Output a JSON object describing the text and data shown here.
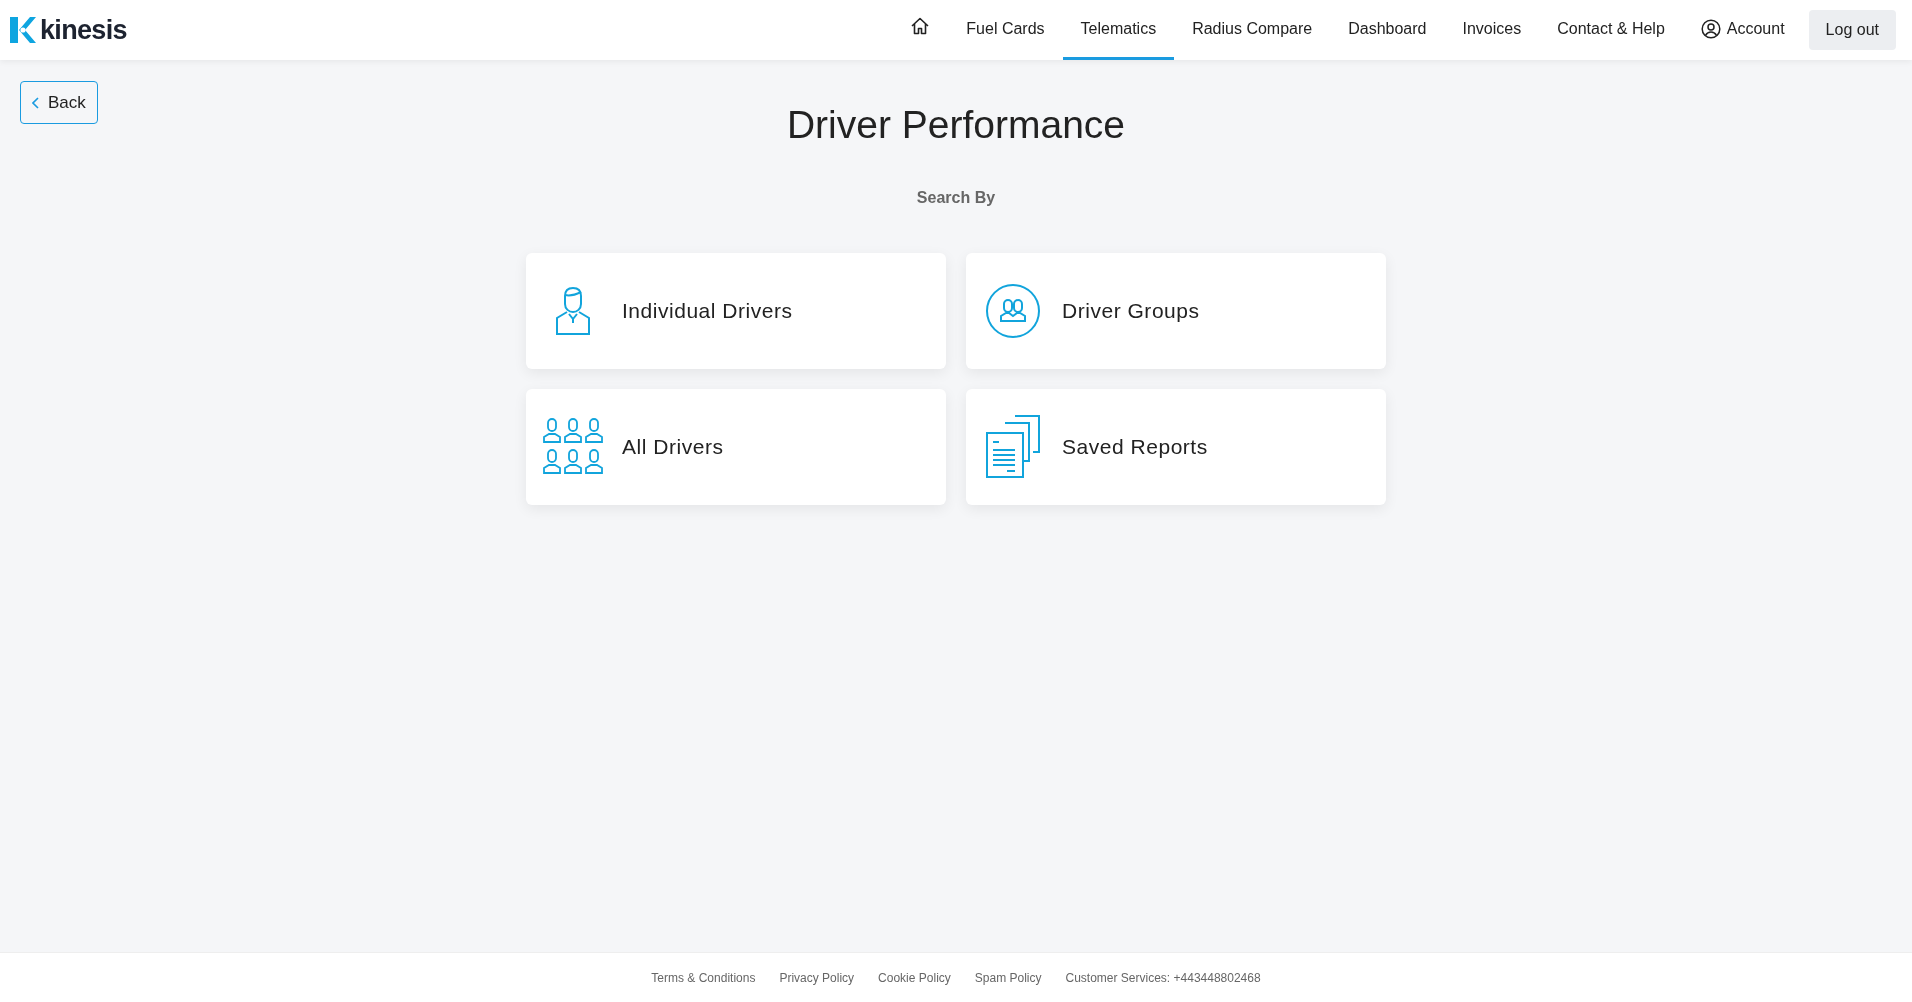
{
  "logo": {
    "text": "kinesis"
  },
  "nav": [
    {
      "kind": "home",
      "selected": false
    },
    {
      "kind": "link",
      "label": "Fuel Cards",
      "selected": false
    },
    {
      "kind": "link",
      "label": "Telematics",
      "selected": true
    },
    {
      "kind": "link",
      "label": "Radius Compare",
      "selected": false
    },
    {
      "kind": "link",
      "label": "Dashboard",
      "selected": false
    },
    {
      "kind": "link",
      "label": "Invoices",
      "selected": false
    },
    {
      "kind": "link",
      "label": "Contact & Help",
      "selected": false
    },
    {
      "kind": "account",
      "label": "Account",
      "selected": false
    }
  ],
  "logout": "Log out",
  "back": "Back",
  "title": "Driver Performance",
  "subtitle": "Search By",
  "cards": [
    {
      "kind": "person",
      "label": "Individual Drivers"
    },
    {
      "kind": "group",
      "label": "Driver Groups"
    },
    {
      "kind": "crowd",
      "label": "All Drivers"
    },
    {
      "kind": "documents",
      "label": "Saved Reports"
    }
  ],
  "footer": [
    "Terms & Conditions",
    "Privacy Policy",
    "Cookie Policy",
    "Spam Policy",
    "Customer Services: +443448802468"
  ]
}
